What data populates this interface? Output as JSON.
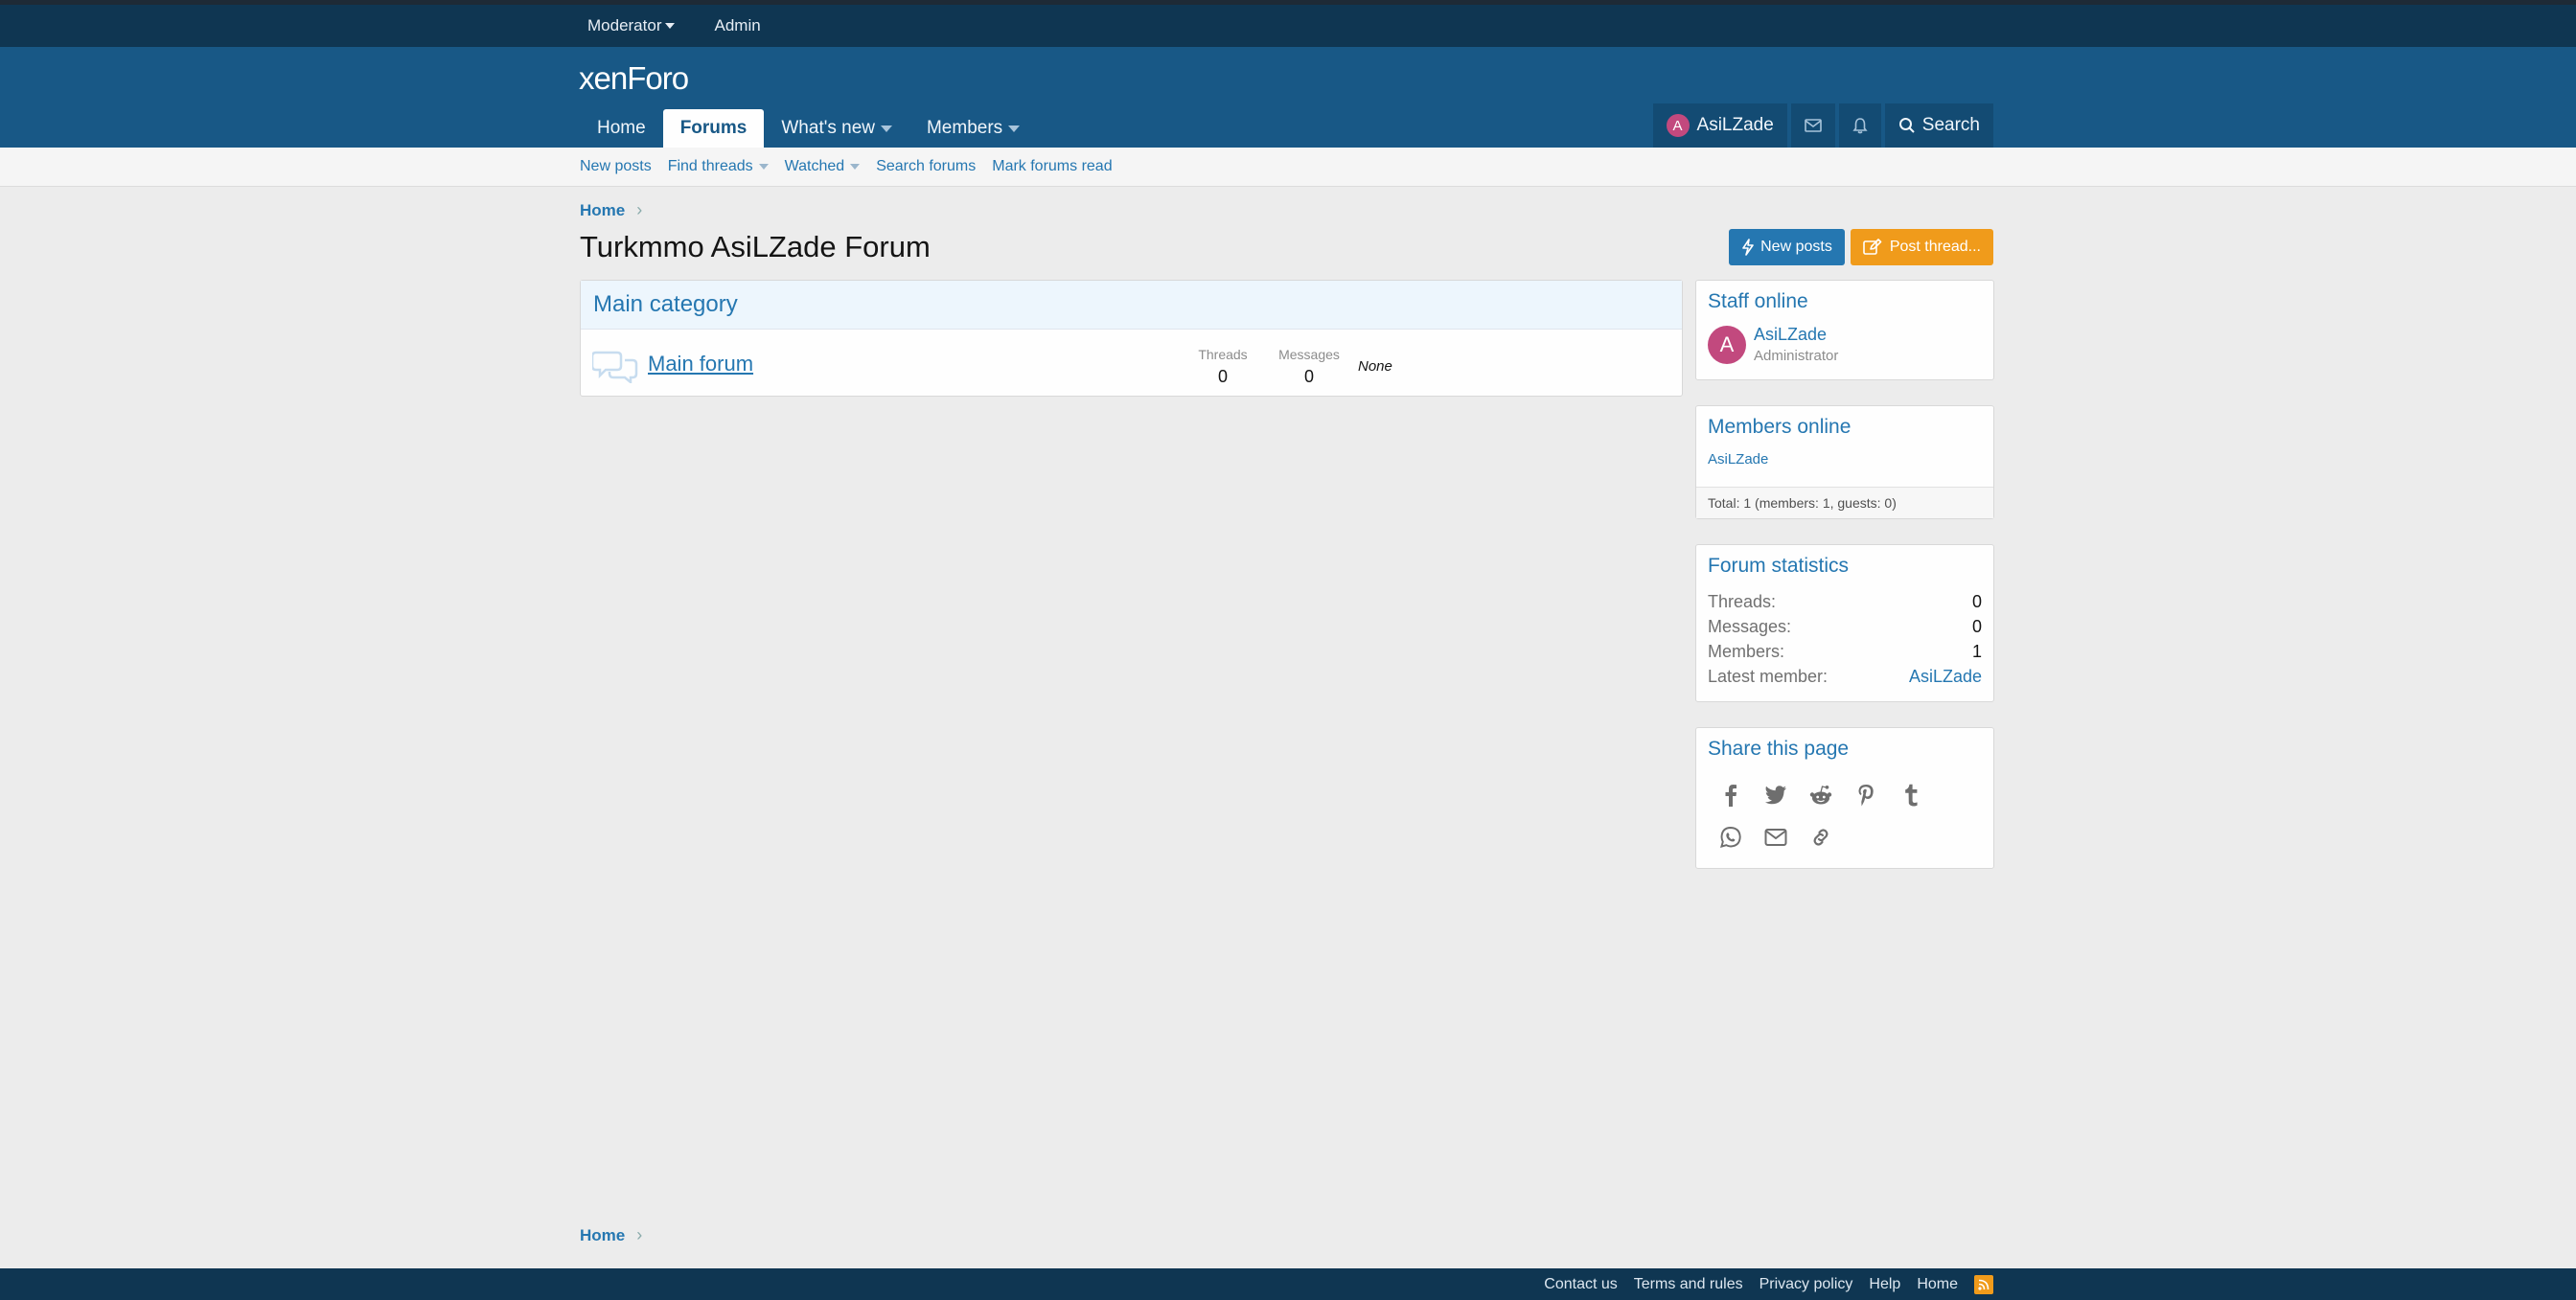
{
  "staff_bar": {
    "moderator": "Moderator",
    "admin": "Admin"
  },
  "header": {
    "logo_text": "xenForo"
  },
  "nav": {
    "tabs": [
      {
        "label": "Home"
      },
      {
        "label": "Forums"
      },
      {
        "label": "What's new"
      },
      {
        "label": "Members"
      }
    ],
    "user": {
      "avatar_letter": "A",
      "name": "AsiLZade"
    },
    "search_label": "Search"
  },
  "subnav": {
    "items": [
      "New posts",
      "Find threads",
      "Watched",
      "Search forums",
      "Mark forums read"
    ]
  },
  "breadcrumb": {
    "home": "Home"
  },
  "page": {
    "title": "Turkmmo AsiLZade Forum",
    "new_posts_btn": "New posts",
    "post_thread_btn": "Post thread..."
  },
  "category": {
    "title": "Main category",
    "forums": [
      {
        "title": "Main forum",
        "threads_label": "Threads",
        "threads": "0",
        "messages_label": "Messages",
        "messages": "0",
        "last_post": "None"
      }
    ]
  },
  "sidebar": {
    "staff": {
      "title": "Staff online",
      "avatar_letter": "A",
      "name": "AsiLZade",
      "role": "Administrator"
    },
    "members": {
      "title": "Members online",
      "list": [
        "AsiLZade"
      ],
      "total": "Total: 1 (members: 1, guests: 0)"
    },
    "stats": {
      "title": "Forum statistics",
      "rows": [
        {
          "k": "Threads:",
          "v": "0"
        },
        {
          "k": "Messages:",
          "v": "0"
        },
        {
          "k": "Members:",
          "v": "1"
        },
        {
          "k": "Latest member:",
          "v": "AsiLZade"
        }
      ]
    },
    "share": {
      "title": "Share this page",
      "icons": [
        "facebook-icon",
        "twitter-icon",
        "reddit-icon",
        "pinterest-icon",
        "tumblr-icon",
        "whatsapp-icon",
        "email-icon",
        "link-icon"
      ]
    }
  },
  "footer": {
    "links": [
      "Contact us",
      "Terms and rules",
      "Privacy policy",
      "Help",
      "Home"
    ]
  },
  "colors": {
    "header": "#185886",
    "staff_bar": "#0f3652",
    "accent": "#2577b1",
    "orange": "#f09b1b",
    "avatar": "#c2497e"
  }
}
